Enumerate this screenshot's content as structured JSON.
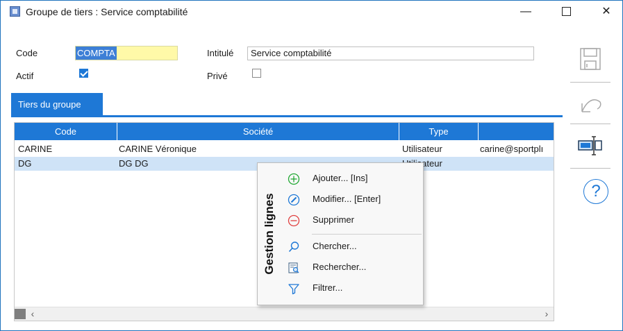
{
  "window": {
    "title": "Groupe de tiers : Service comptabilité",
    "minimize_glyph": "—",
    "maximize_glyph": "☐",
    "close_glyph": "✕"
  },
  "form": {
    "code_label": "Code",
    "code_value": "COMPTA",
    "intitule_label": "Intitulé",
    "intitule_value": "Service comptabilité",
    "actif_label": "Actif",
    "actif_checked": true,
    "prive_label": "Privé",
    "prive_checked": false
  },
  "tabs": [
    {
      "label": "Tiers du groupe",
      "active": true
    }
  ],
  "grid": {
    "columns": [
      "Code",
      "Société",
      "Type",
      ""
    ],
    "rows": [
      {
        "code": "CARINE",
        "societe": "CARINE Véronique",
        "type": "Utilisateur",
        "email": "carine@sportplı",
        "selected": false
      },
      {
        "code": "DG",
        "societe": "DG DG",
        "type": "Utilisateur",
        "email": "",
        "selected": true
      }
    ],
    "scroll_left": "‹",
    "scroll_right": "›"
  },
  "context_menu": {
    "group_label": "Gestion lignes",
    "items": [
      {
        "label": "Ajouter... [Ins]",
        "icon": "add-circle-icon"
      },
      {
        "label": "Modifier... [Enter]",
        "icon": "edit-pencil-icon"
      },
      {
        "label": "Supprimer",
        "icon": "remove-circle-icon"
      },
      {
        "label": "Chercher...",
        "icon": "search-icon"
      },
      {
        "label": "Rechercher...",
        "icon": "advanced-search-icon"
      },
      {
        "label": "Filtrer...",
        "icon": "filter-icon"
      }
    ]
  },
  "right_toolbar": {
    "help_glyph": "?",
    "tools": [
      "save-icon",
      "undo-icon",
      "columns-resize-icon",
      "help-icon"
    ]
  },
  "colors": {
    "accent": "#1e78d6",
    "selected_row": "#cfe3f7",
    "code_field_bg": "#fff9a8",
    "add_icon": "#22a834",
    "remove_icon": "#e04040",
    "icon_blue": "#1e78d6"
  }
}
